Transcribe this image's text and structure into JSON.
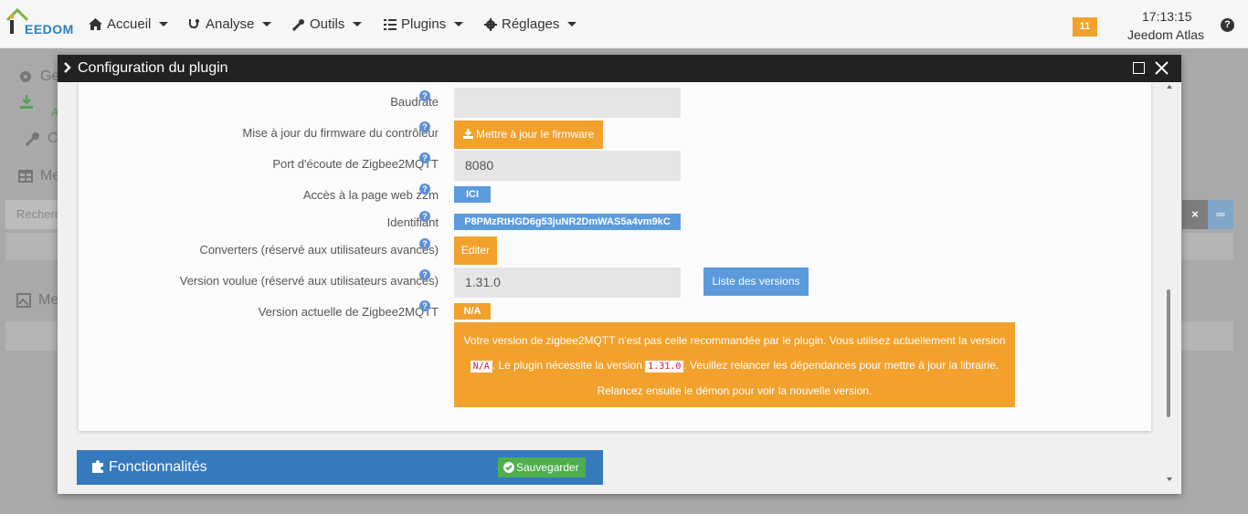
{
  "navbar": {
    "logo_text": "EEDOM",
    "items": [
      {
        "label": "Accueil",
        "icon": "home-icon"
      },
      {
        "label": "Analyse",
        "icon": "stethoscope-icon"
      },
      {
        "label": "Outils",
        "icon": "wrench-icon"
      },
      {
        "label": "Plugins",
        "icon": "tasks-icon"
      },
      {
        "label": "Réglages",
        "icon": "gear-icon"
      }
    ],
    "notification_count": "11",
    "clock": "17:13:15",
    "user": "Jeedom Atlas",
    "help_label": "?"
  },
  "background": {
    "row1": "Ge",
    "row2": "A",
    "row3": "C",
    "row4": "Me",
    "search_placeholder": "Recherc",
    "row5": "Me",
    "x_label": "×",
    "eq_label": "═"
  },
  "modal": {
    "title": "Configuration du plugin",
    "fields": {
      "baudrate_label": "Baudrate",
      "baudrate_value": "",
      "firmware_label": "Mise à jour du firmware du contrôleur",
      "firmware_button": "Mettre à jour le firmware",
      "port_label": "Port d'écoute de Zigbee2MQTT",
      "port_value": "8080",
      "webpage_label": "Accès à la page web z2m",
      "webpage_tag": "ICI",
      "id_label": "Identifiant",
      "id_value": "P8PMzRtHGD6g53juNR2DmWAS5a4vm9kC",
      "converters_label": "Converters (réservé aux utilisateurs avancés)",
      "converters_button": "Editer",
      "version_wanted_label": "Version voulue (réservé aux utilisateurs avancés)",
      "version_wanted_value": "1.31.0",
      "versions_button": "Liste des versions",
      "version_current_label": "Version actuelle de Zigbee2MQTT",
      "version_current_tag": "N/A"
    },
    "alert": {
      "part1": "Votre version de zigbee2MQTT n'est pas celle recommandée par le plugin. Vous utilisez actuellement la version",
      "code1": "N/A",
      "part2": ". Le plugin nécessite la version",
      "code2": "1.31.0",
      "part3": ". Veuillez relancer les dépendances pour mettre à jour la librairie. Relancez ensuite le démon pour voir la nouvelle version."
    },
    "features": {
      "title": "Fonctionnalités",
      "save_button": "Sauvegarder"
    }
  },
  "colors": {
    "navbar_bg": "#f6f6f6",
    "modal_header": "#222222",
    "orange": "#f2a12c",
    "blue": "#5b9bdb",
    "features_bar": "#357abd",
    "green": "#4cae4c"
  }
}
